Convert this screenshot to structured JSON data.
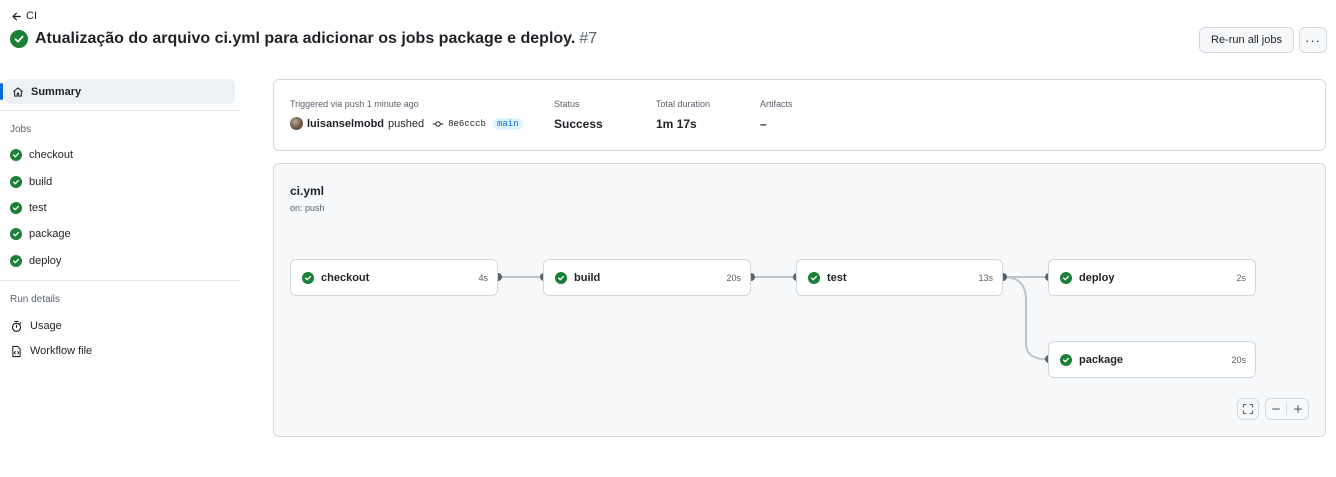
{
  "header": {
    "back_label": "CI",
    "title": "Atualização do arquivo ci.yml para adicionar os jobs package e deploy.",
    "run_number": "#7",
    "rerun_label": "Re-run all jobs",
    "more_label": "···"
  },
  "sidebar": {
    "summary_label": "Summary",
    "jobs_heading": "Jobs",
    "jobs": [
      {
        "label": "checkout"
      },
      {
        "label": "build"
      },
      {
        "label": "test"
      },
      {
        "label": "package"
      },
      {
        "label": "deploy"
      }
    ],
    "run_details_heading": "Run details",
    "usage_label": "Usage",
    "workflow_file_label": "Workflow file"
  },
  "summary_card": {
    "trigger_label": "Triggered via push 1 minute ago",
    "actor": "luisanselmobd",
    "action": "pushed",
    "commit_sha": "8e6cccb",
    "branch": "main",
    "status_label": "Status",
    "status_value": "Success",
    "duration_label": "Total duration",
    "duration_value": "1m 17s",
    "artifacts_label": "Artifacts",
    "artifacts_value": "–"
  },
  "workflow": {
    "name": "ci.yml",
    "on": "on: push",
    "jobs": [
      {
        "name": "checkout",
        "duration": "4s"
      },
      {
        "name": "build",
        "duration": "20s"
      },
      {
        "name": "test",
        "duration": "13s"
      },
      {
        "name": "deploy",
        "duration": "2s"
      },
      {
        "name": "package",
        "duration": "20s"
      }
    ]
  },
  "colors": {
    "success": "#1a7f37",
    "accent": "#0969da",
    "border": "#d1d9e0"
  },
  "icons": {
    "back": "arrow-left-icon",
    "status": "check-circle-fill-icon",
    "summary": "home-icon",
    "usage": "stopwatch-icon",
    "workflow_file": "file-code-icon",
    "commit": "git-commit-icon",
    "fullscreen": "screen-full-icon",
    "zoom_out": "dash-icon",
    "zoom_in": "plus-icon"
  }
}
